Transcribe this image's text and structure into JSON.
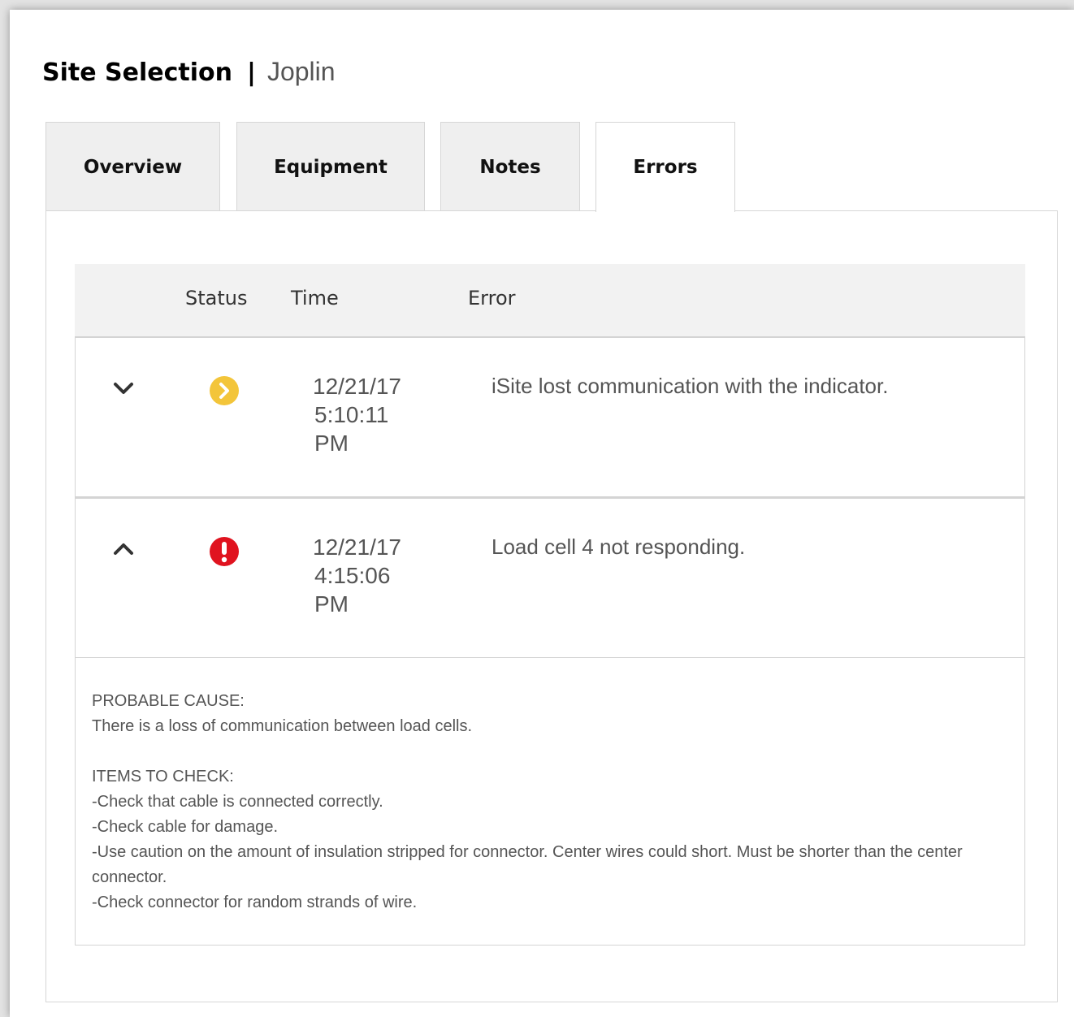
{
  "header": {
    "title": "Site Selection",
    "separator": "|",
    "site_name": "Joplin"
  },
  "tabs": [
    {
      "label": "Overview",
      "active": false
    },
    {
      "label": "Equipment",
      "active": false
    },
    {
      "label": "Notes",
      "active": false
    },
    {
      "label": "Errors",
      "active": true
    }
  ],
  "table": {
    "columns": {
      "status": "Status",
      "time": "Time",
      "error": "Error"
    },
    "rows": [
      {
        "expanded": false,
        "status": "warning",
        "status_color": "#f3c53a",
        "time_date": "12/21/17",
        "time_clock": "5:10:11",
        "time_ampm": "PM",
        "error": "iSite lost communication with the indicator."
      },
      {
        "expanded": true,
        "status": "error",
        "status_color": "#e0131f",
        "time_date": "12/21/17",
        "time_clock": "4:15:06",
        "time_ampm": "PM",
        "error": "Load cell 4 not responding."
      }
    ]
  },
  "details": {
    "cause_heading": "PROBABLE CAUSE:",
    "cause_text": "There is a loss of communication between load cells.",
    "check_heading": "ITEMS TO CHECK:",
    "check_items": [
      "-Check that cable is connected correctly.",
      "-Check cable for damage.",
      "-Use caution on the amount of insulation stripped for connector. Center wires could short. Must be shorter than the center connector.",
      "-Check connector for random strands of wire."
    ]
  },
  "icons": {
    "row1_toggle": "chevron-down-icon",
    "row1_status": "warning-arrow-icon",
    "row2_toggle": "chevron-up-icon",
    "row2_status": "error-exclamation-icon"
  }
}
